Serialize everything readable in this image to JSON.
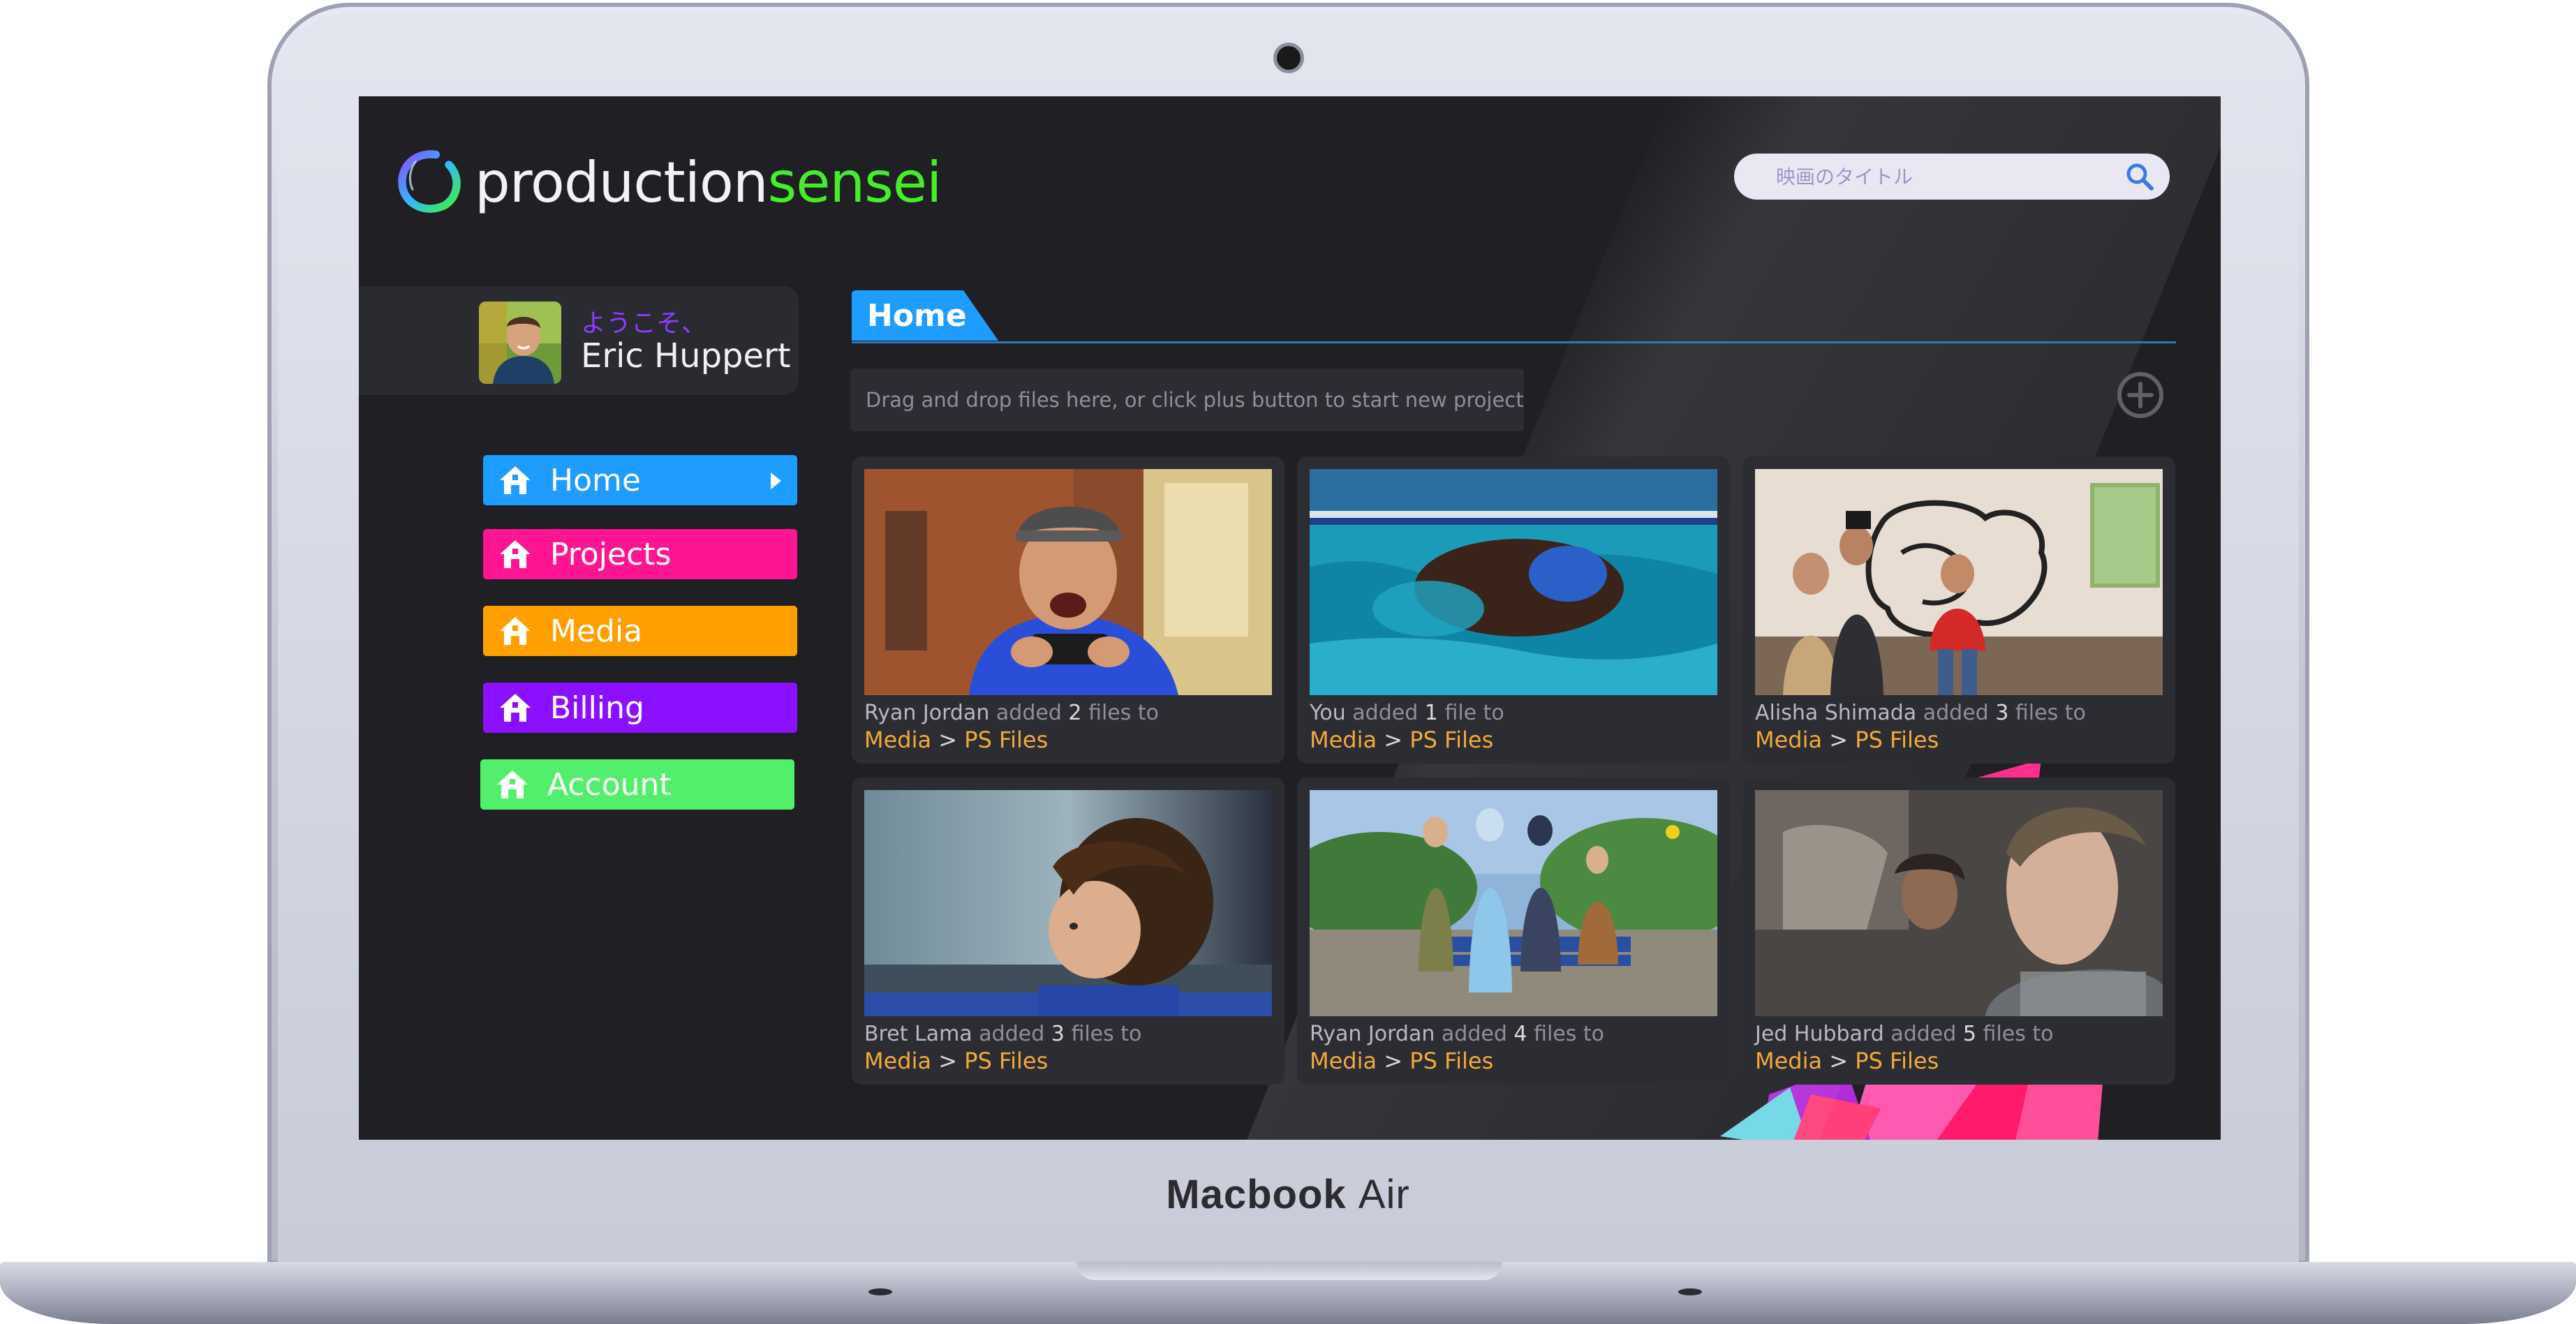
{
  "app": {
    "logo_word_a": "production",
    "logo_word_b": "sensei",
    "device_label_bold": "Macbook",
    "device_label_thin": "Air"
  },
  "search": {
    "placeholder": "映画のタイトル",
    "icon": "search-icon"
  },
  "welcome": {
    "greeting": "ようこそ、",
    "user_name": "Eric Huppert"
  },
  "nav": {
    "items": [
      {
        "label": "Home",
        "color": "#1e9cff",
        "icon": "house-icon",
        "active": true
      },
      {
        "label": "Projects",
        "color": "#ff1493",
        "icon": "house-icon",
        "active": false
      },
      {
        "label": "Media",
        "color": "#ffa000",
        "icon": "house-icon",
        "active": false
      },
      {
        "label": "Billing",
        "color": "#8a10ff",
        "icon": "house-icon",
        "active": false
      },
      {
        "label": "Account",
        "color": "#52f06a",
        "icon": "house-icon",
        "active": false
      }
    ]
  },
  "main": {
    "title": "Home",
    "drop_hint": "Drag and drop files here, or click plus button to start new project",
    "add_icon": "plus-circle-icon",
    "cards": [
      {
        "who": "Ryan Jordan",
        "verb": "added",
        "count": "2",
        "tail": "files to",
        "folder": "Media",
        "separator": ">",
        "subfolder": "PS Files",
        "thumb": "man-with-phone"
      },
      {
        "who": "You",
        "verb": "added",
        "count": "1",
        "tail": "file to",
        "folder": "Media",
        "separator": ">",
        "subfolder": "PS Files",
        "thumb": "swimmer"
      },
      {
        "who": "Alisha Shimada",
        "verb": "added",
        "count": "3",
        "tail": "files to",
        "folder": "Media",
        "separator": ">",
        "subfolder": "PS Files",
        "thumb": "film-set-painting"
      },
      {
        "who": "Bret Lama",
        "verb": "added",
        "count": "3",
        "tail": "files to",
        "folder": "Media",
        "separator": ">",
        "subfolder": "PS Files",
        "thumb": "boy-at-window"
      },
      {
        "who": "Ryan Jordan",
        "verb": "added",
        "count": "4",
        "tail": "files to",
        "folder": "Media",
        "separator": ">",
        "subfolder": "PS Files",
        "thumb": "group-on-bench"
      },
      {
        "who": "Jed Hubbard",
        "verb": "added",
        "count": "5",
        "tail": "files to",
        "folder": "Media",
        "separator": ">",
        "subfolder": "PS Files",
        "thumb": "car-passengers"
      }
    ]
  },
  "colors": {
    "accent_green": "#46ee2a",
    "accent_blue": "#1e9cff",
    "link_orange": "#f2a93b",
    "screen_bg": "#1f1f24"
  }
}
